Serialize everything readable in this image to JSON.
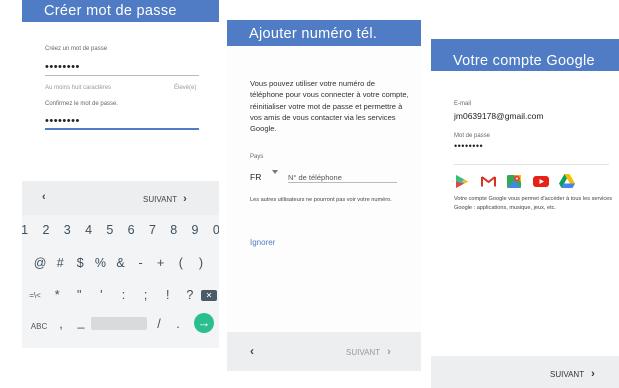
{
  "screen1": {
    "title": "Créer mot de passe",
    "create_label": "Créez un mot de passe",
    "password_value": "••••••••",
    "hint": "Au moins huit caractères",
    "strength": "Élevé(e)",
    "confirm_label": "Confirmez le mot de passe.",
    "confirm_value": "••••••••",
    "next_label": "SUIVANT",
    "keyboard": {
      "row1": [
        "1",
        "2",
        "3",
        "4",
        "5",
        "6",
        "7",
        "8",
        "9",
        "0"
      ],
      "row2": [
        "@",
        "#",
        "$",
        "%",
        "&",
        "-",
        "+",
        "(",
        ")"
      ],
      "row3_left": "=\\<",
      "row3": [
        "*",
        "\"",
        "'",
        ":",
        ";",
        "!",
        "?"
      ],
      "abc": "ABC",
      "comma": ",",
      "underscore": "_",
      "slash": "/",
      "period": "."
    }
  },
  "screen2": {
    "title": "Ajouter numéro tél.",
    "description": "Vous pouvez utiliser votre numéro de téléphone pour vous connecter à votre compte, réinitialiser votre mot de passe et permettre à vos amis de vous contacter via les services Google.",
    "country_label": "Pays",
    "country_value": "FR",
    "phone_placeholder": "N° de téléphone",
    "notice": "Les autres utilisateurs ne pourront pas voir votre numéro.",
    "ignore_label": "Ignorer",
    "next_label": "SUIVANT"
  },
  "screen3": {
    "title": "Votre compte Google",
    "email_label": "E-mail",
    "email_value": "jm0639178@gmail.com",
    "password_label": "Mot de passe",
    "password_value": "••••••••",
    "services_text": "Votre compte Google vous permet d'accéder à tous les services Google : applications, musique, jeux, etc.",
    "next_label": "SUIVANT",
    "app_icons": [
      "play-store-icon",
      "gmail-icon",
      "maps-icon",
      "youtube-icon",
      "drive-icon"
    ]
  }
}
